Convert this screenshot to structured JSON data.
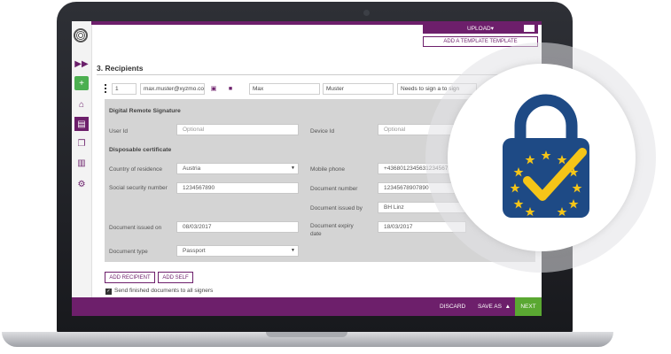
{
  "header": {
    "upload_label": "UPLOAD",
    "template_label": "ADD A TEMPLATE TEMPLATE"
  },
  "section": {
    "title": "3. Recipients"
  },
  "recipient": {
    "order": "1",
    "email": "max.muster@xyzmo.co",
    "first_name": "Max",
    "last_name": "Muster",
    "action": "Needs to sign a to sign"
  },
  "signature": {
    "heading": "Digital Remote Signature",
    "user_id_label": "User Id",
    "user_id_placeholder": "Optional",
    "device_id_label": "Device Id",
    "device_id_placeholder": "Optional"
  },
  "certificate": {
    "heading": "Disposable certificate",
    "country_label": "Country of residence",
    "country_value": "Austria",
    "mobile_label": "Mobile phone",
    "mobile_value": "+4368012345631234567",
    "ssn_label": "Social security number",
    "ssn_value": "1234567890",
    "docnum_label": "Document number",
    "docnum_value": "12345678907890",
    "issued_by_label": "Document issued by",
    "issued_by_value": "BH Linz",
    "issued_on_label": "Document issued on",
    "issued_on_value": "08/03/2017",
    "expiry_label": "Document expiry date",
    "expiry_value": "18/03/2017",
    "doctype_label": "Document type",
    "doctype_value": "Passport"
  },
  "actions": {
    "add_recipient": "ADD RECIPIENT",
    "add_self": "ADD SELF",
    "send_finished": "Send finished documents to all signers"
  },
  "footer": {
    "discard": "DISCARD",
    "save_as": "SAVE AS",
    "next": "NEXT"
  },
  "colors": {
    "brand": "#6d1f6b",
    "next": "#5aa832",
    "lock_body": "#1e4a85",
    "lock_check": "#f5c518"
  }
}
